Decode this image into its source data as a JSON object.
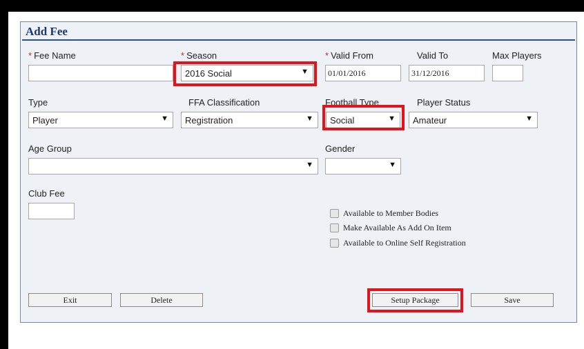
{
  "title": "Add Fee",
  "fields": {
    "fee_name": {
      "label": "Fee Name",
      "value": ""
    },
    "season": {
      "label": "Season",
      "value": "2016 Social"
    },
    "valid_from": {
      "label": "Valid From",
      "value": "01/01/2016"
    },
    "valid_to": {
      "label": "Valid To",
      "value": "31/12/2016"
    },
    "max_players": {
      "label": "Max Players",
      "value": ""
    },
    "type": {
      "label": "Type",
      "value": "Player"
    },
    "ffa_classification": {
      "label": "FFA Classification",
      "value": "Registration"
    },
    "football_type": {
      "label": "Football Type",
      "value": "Social"
    },
    "player_status": {
      "label": "Player Status",
      "value": "Amateur"
    },
    "age_group": {
      "label": "Age Group",
      "value": ""
    },
    "gender": {
      "label": "Gender",
      "value": ""
    },
    "club_fee": {
      "label": "Club Fee",
      "value": ""
    }
  },
  "required_marker": "*",
  "dropdown_arrow": "▼",
  "checkboxes": [
    {
      "label": "Available to Member Bodies",
      "checked": false
    },
    {
      "label": "Make Available As Add On Item",
      "checked": false
    },
    {
      "label": "Available to Online Self Registration",
      "checked": false
    }
  ],
  "buttons": {
    "exit": "Exit",
    "delete": "Delete",
    "setup_package": "Setup Package",
    "save": "Save"
  },
  "colors": {
    "highlight": "#e2131b",
    "title": "#1c3a6e",
    "panel_bg": "#eef1f5",
    "required": "#d9261c"
  }
}
